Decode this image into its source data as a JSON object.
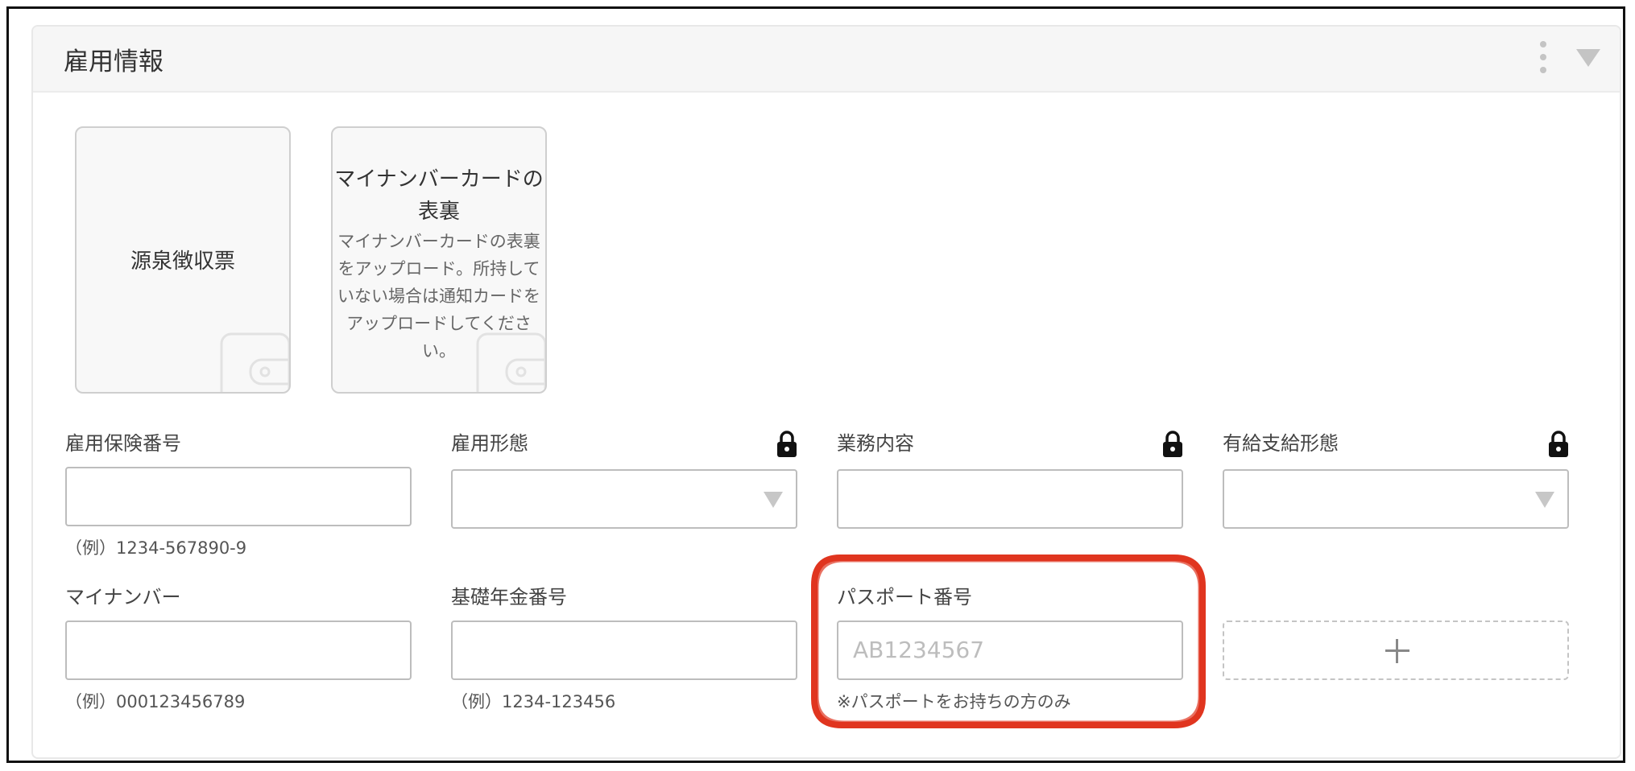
{
  "section": {
    "title": "雇用情報"
  },
  "documents": [
    {
      "title": "源泉徴収票",
      "description": ""
    },
    {
      "title": "マイナンバーカードの表裏",
      "description": "マイナンバーカードの表裏をアップロード。所持していない場合は通知カードをアップロードしてください。"
    }
  ],
  "fields": {
    "employment_insurance": {
      "label": "雇用保険番号",
      "value": "",
      "hint": "（例）1234-567890-9"
    },
    "employment_type": {
      "label": "雇用形態",
      "selected": "",
      "locked": true
    },
    "job_description": {
      "label": "業務内容",
      "value": "",
      "locked": true
    },
    "paid_leave_type": {
      "label": "有給支給形態",
      "selected": "",
      "locked": true
    },
    "my_number": {
      "label": "マイナンバー",
      "value": "",
      "hint": "（例）000123456789"
    },
    "pension_number": {
      "label": "基礎年金番号",
      "value": "",
      "hint": "（例）1234-123456"
    },
    "passport_number": {
      "label": "パスポート番号",
      "value": "",
      "placeholder": "AB1234567",
      "hint": "※パスポートをお持ちの方のみ"
    }
  },
  "icons": {
    "lock": "lock-icon",
    "menu": "kebab-menu-icon",
    "collapse": "triangle-down-icon",
    "add": "plus-icon",
    "upload": "wallet-icon"
  },
  "colors": {
    "highlight": "#e0351f",
    "header_bg": "#f6f6f6",
    "border": "#bdbdbd"
  }
}
